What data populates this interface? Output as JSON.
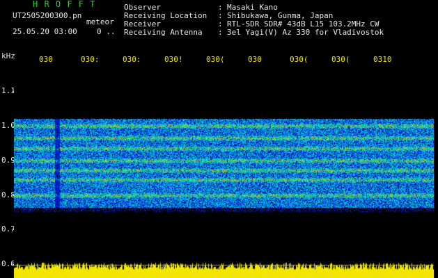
{
  "app": {
    "title": "H R O F F T",
    "file_name": "UT2505200300.pn",
    "file_suffix": "meteor",
    "timestamp": "25.05.20 03:00",
    "flag": "0 .."
  },
  "header": [
    {
      "label": "Observer",
      "value": "Masaki Kano"
    },
    {
      "label": "Receiving Location",
      "value": "Shibukawa, Gunma, Japan"
    },
    {
      "label": "Receiver",
      "value": "RTL-SDR SDR# 43dB L15 103.2MHz CW"
    },
    {
      "label": "Receiving Antenna",
      "value": "3el Yagi(V) Az 330 for Vladivostok"
    }
  ],
  "y_axis": {
    "unit": "kHz",
    "ticks": [
      "1.1",
      "1.0",
      "0.9",
      "0.8",
      "0.7",
      "0.6"
    ]
  },
  "x_axis": {
    "ticks": [
      "030",
      "0302",
      "0303",
      "0305",
      "0306",
      "0307",
      "0308",
      "0309",
      "0310"
    ],
    "display_ticks": [
      "030",
      "030:",
      "030:",
      "030!",
      "030(",
      "030",
      "030(",
      "030(",
      "0310"
    ]
  },
  "spectrogram": {
    "description_bands_khz": [
      1.0,
      0.97,
      0.935,
      0.9,
      0.875,
      0.845,
      0.8
    ],
    "baseline_color": "#f2e600",
    "background": "#000000"
  }
}
